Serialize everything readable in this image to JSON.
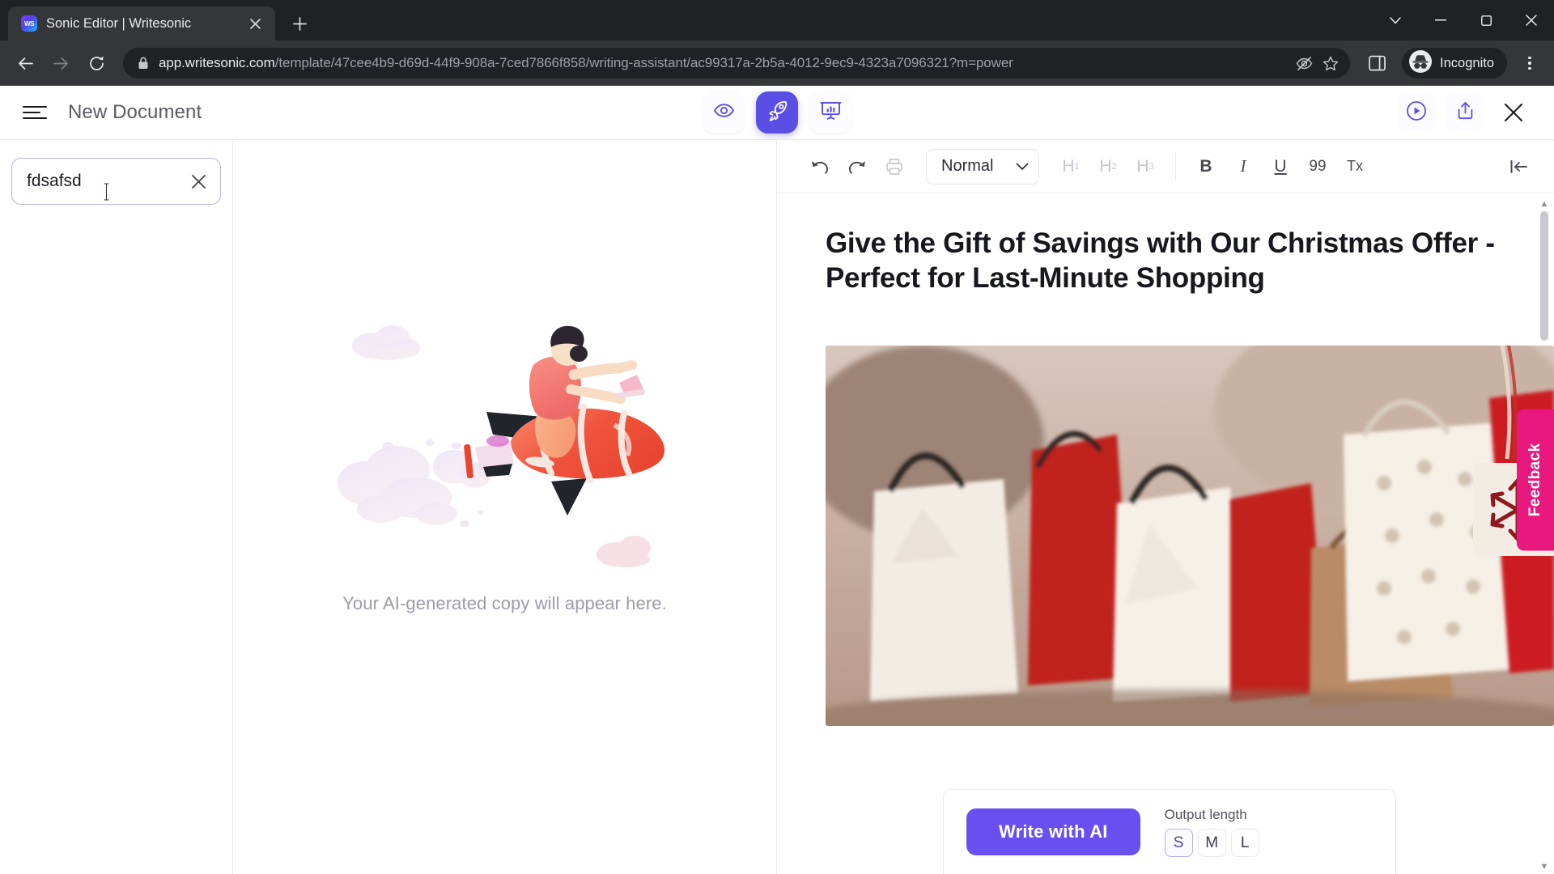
{
  "browser": {
    "tab": {
      "title": "Sonic Editor | Writesonic",
      "favicon_text": "WS",
      "favicon_name": "writesonic-favicon",
      "close_icon": "close-icon"
    },
    "new_tab_icon": "plus-icon",
    "window_controls": [
      "chevron-down-icon",
      "minimize-icon",
      "maximize-icon",
      "close-icon"
    ],
    "nav": {
      "back_icon": "arrow-back-icon",
      "forward_icon": "arrow-forward-icon",
      "reload_icon": "reload-icon"
    },
    "omnibox": {
      "lock_icon": "lock-icon",
      "host": "app.writesonic.com",
      "path": "/template/47cee4b9-d69d-44f9-908a-7ced7866f858/writing-assistant/ac99317a-2b5a-4012-9ec9-4323a7096321?m=power",
      "tracking_icon": "eye-slash-icon",
      "bookmark_icon": "star-icon"
    },
    "right": {
      "side_panel_icon": "side-panel-icon",
      "incognito_icon": "incognito-icon",
      "incognito_label": "Incognito",
      "menu_icon": "three-dots-icon"
    }
  },
  "app": {
    "header": {
      "menu_icon": "hamburger-menu-icon",
      "document_title": "New Document",
      "modes": [
        {
          "name": "preview-mode",
          "icon": "eye-icon",
          "active": false
        },
        {
          "name": "power-mode",
          "icon": "rocket-icon",
          "active": true
        },
        {
          "name": "analytics-mode",
          "icon": "presentation-chart-icon",
          "active": false
        }
      ],
      "actions": [
        {
          "name": "play-tutorial-button",
          "icon": "play-circle-icon"
        },
        {
          "name": "share-button",
          "icon": "share-upload-icon"
        },
        {
          "name": "close-editor-button",
          "icon": "close-icon"
        }
      ]
    },
    "left_panel": {
      "input_value": "fdsafsd",
      "input_placeholder": "",
      "clear_icon": "close-icon"
    },
    "output_panel": {
      "illustration": "rocket-illustration",
      "empty_text": "Your AI-generated copy will appear here."
    },
    "editor": {
      "toolbar": {
        "undo_icon": "undo-icon",
        "redo_icon": "redo-icon",
        "print_icon": "print-icon",
        "style_value": "Normal",
        "style_caret_icon": "chevron-down-icon",
        "headings": [
          "H1",
          "H2",
          "H3"
        ],
        "bold_label": "B",
        "italic_label": "I",
        "underline_label": "U",
        "quote_label": "99",
        "clear_format_label": "Tx",
        "collapse_icon": "collapse-panel-icon"
      },
      "heading": "Give the Gift of Savings with Our Christmas Offer - Perfect for Last-Minute Shopping",
      "image_alt": "christmas-shopping-bags-photo",
      "scroll_up_icon": "chevron-up-icon",
      "scroll_down_icon": "chevron-down-icon"
    },
    "action_bar": {
      "write_button": "Write with AI",
      "output_length_label": "Output length",
      "lengths": [
        {
          "label": "S",
          "selected": true
        },
        {
          "label": "M",
          "selected": false
        },
        {
          "label": "L",
          "selected": false
        }
      ]
    },
    "feedback_tab": "Feedback",
    "colors": {
      "accent_purple": "#6a4ff0",
      "mode_active": "#5b4ee5",
      "feedback_pink": "#e8187f",
      "chrome_dark": "#35363a"
    }
  }
}
